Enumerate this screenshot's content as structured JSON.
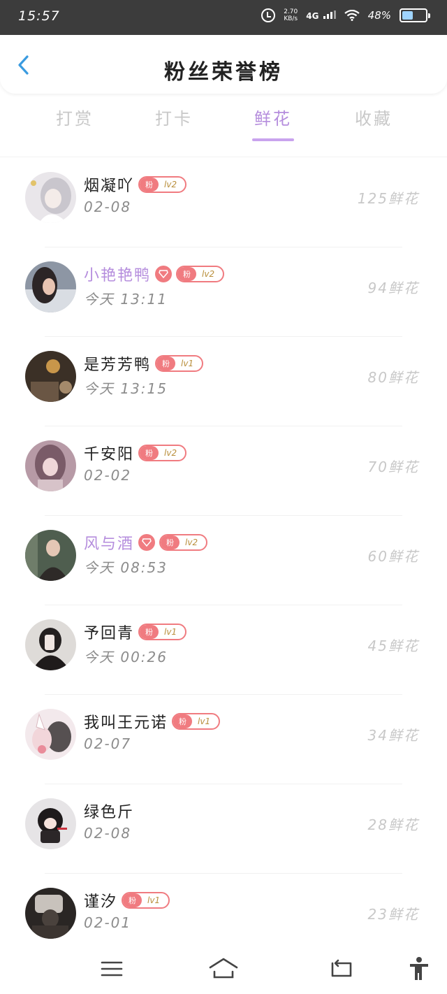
{
  "status_bar": {
    "time": "15:57",
    "net_speed_value": "2.70",
    "net_speed_unit": "KB/s",
    "network": "4G",
    "battery": "48%",
    "battery_level": 0.48
  },
  "header": {
    "title": "粉丝荣誉榜"
  },
  "tabs": [
    {
      "label": "打赏",
      "active": false
    },
    {
      "label": "打卡",
      "active": false
    },
    {
      "label": "鲜花",
      "active": true
    },
    {
      "label": "收藏",
      "active": false
    }
  ],
  "fans": [
    {
      "name": "烟凝吖",
      "vip": false,
      "fan_label": "粉",
      "level": "lv2",
      "date": "02-08",
      "amount": "125鲜花"
    },
    {
      "name": "小艳艳鸭",
      "vip": true,
      "fan_label": "粉",
      "level": "lv2",
      "date": "今天 13:11",
      "amount": "94鲜花"
    },
    {
      "name": "是芳芳鸭",
      "vip": false,
      "fan_label": "粉",
      "level": "lv1",
      "date": "今天 13:15",
      "amount": "80鲜花"
    },
    {
      "name": "千安阳",
      "vip": false,
      "fan_label": "粉",
      "level": "lv2",
      "date": "02-02",
      "amount": "70鲜花"
    },
    {
      "name": "风与酒",
      "vip": true,
      "fan_label": "粉",
      "level": "lv2",
      "date": "今天 08:53",
      "amount": "60鲜花"
    },
    {
      "name": "予回青",
      "vip": false,
      "fan_label": "粉",
      "level": "lv1",
      "date": "今天 00:26",
      "amount": "45鲜花"
    },
    {
      "name": "我叫王元诺",
      "vip": false,
      "fan_label": "粉",
      "level": "lv1",
      "date": "02-07",
      "amount": "34鲜花"
    },
    {
      "name": "绿色斤",
      "vip": false,
      "fan_label": "",
      "level": "",
      "date": "02-08",
      "amount": "28鲜花"
    },
    {
      "name": "谨汐",
      "vip": false,
      "fan_label": "粉",
      "level": "lv1",
      "date": "02-01",
      "amount": "23鲜花"
    }
  ],
  "colors": {
    "accent": "#b58ddd",
    "badge": "#f07b80",
    "back_arrow": "#3a9be0"
  },
  "nav_bar": {
    "icons": [
      "menu-icon",
      "home-icon",
      "back-icon",
      "accessibility-icon"
    ]
  }
}
